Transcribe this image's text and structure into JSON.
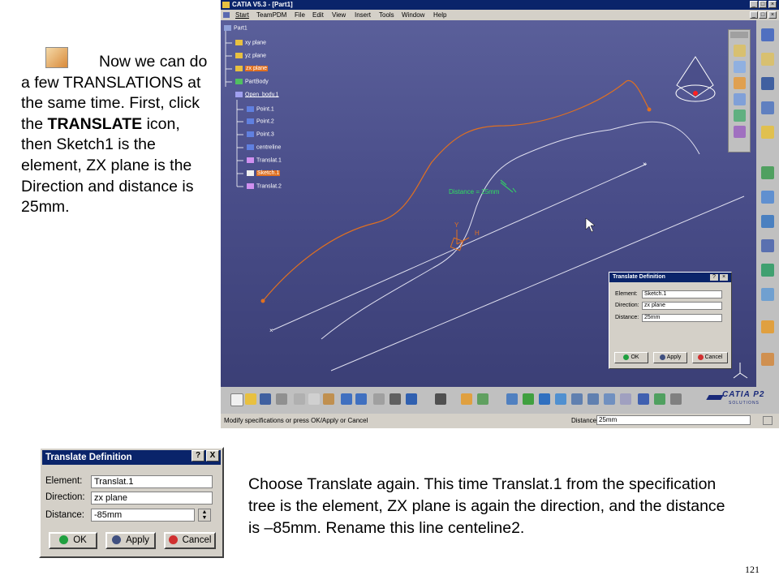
{
  "slide": {
    "intro_text_before": "Now we can do a few TRANSLATIONS at the same time. First, click  the ",
    "intro_bold": "TRANSLATE",
    "intro_text_after": " icon, then Sketch1 is the element, ZX plane is the Direction and distance is 25mm.",
    "outro_text": "Choose Translate again. This time Translat.1 from the specification tree is the element, ZX plane is again the direction, and the distance is –85mm. Rename this line centeline2.",
    "page_number": "121"
  },
  "catia": {
    "title": "CATIA V5.3 - [Part1]",
    "menu": [
      "Start",
      "TeamPDM",
      "File",
      "Edit",
      "View",
      "Insert",
      "Tools",
      "Window",
      "Help"
    ],
    "tree": [
      {
        "label": "Part1",
        "highlight": false
      },
      {
        "label": "xy plane",
        "highlight": false
      },
      {
        "label": "yz plane",
        "highlight": false
      },
      {
        "label": "zx plane",
        "highlight": true
      },
      {
        "label": "PartBody",
        "highlight": false
      },
      {
        "label": "Open_body.1",
        "highlight": false
      },
      {
        "label": "Point.1",
        "highlight": false
      },
      {
        "label": "Point.2",
        "highlight": false
      },
      {
        "label": "Point.3",
        "highlight": false
      },
      {
        "label": "centreline",
        "highlight": false
      },
      {
        "label": "Translat.1",
        "highlight": false
      },
      {
        "label": "Sketch.1",
        "highlight": true
      },
      {
        "label": "Translat.2",
        "highlight": false
      }
    ],
    "distance_label": "Distance = 25mm",
    "axis_labels": {
      "y": "Y",
      "h": "H"
    },
    "status_text": "Modify specifications or press OK/Apply or Cancel",
    "status_distance_label": "Distance",
    "status_distance_value": "25mm",
    "logo_text": "CATIA P2",
    "logo_sub": "SOLUTIONS",
    "colors": {
      "viewport_top": "#5a5f9a",
      "viewport_bottom": "#3b3f76",
      "curve": "#e07020",
      "highlight": "#e07020",
      "title_bar": "#0a246a"
    },
    "small_dialog": {
      "title": "Translate Definition",
      "element_label": "Element:",
      "element_value": "Sketch.1",
      "direction_label": "Direction:",
      "direction_value": "zx plane",
      "distance_label": "Distance:",
      "distance_value": "25mm",
      "ok": "OK",
      "apply": "Apply",
      "cancel": "Cancel"
    }
  },
  "big_dialog": {
    "title": "Translate Definition",
    "help_glyph": "?",
    "close_glyph": "X",
    "element_label": "Element:",
    "element_value": "Translat.1",
    "direction_label": "Direction:",
    "direction_value": "zx plane",
    "distance_label": "Distance:",
    "distance_value": "-85mm",
    "ok": "OK",
    "apply": "Apply",
    "cancel": "Cancel"
  }
}
